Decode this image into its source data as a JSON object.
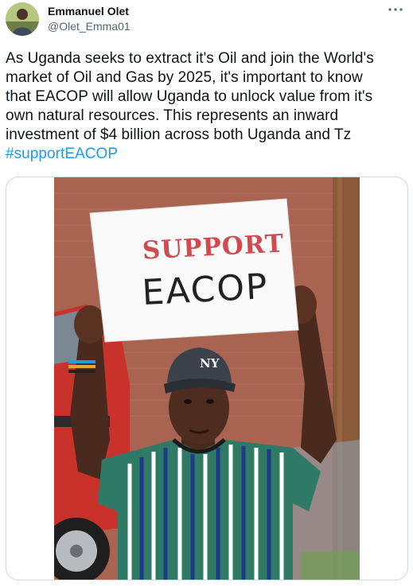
{
  "user": {
    "name": "Emmanuel Olet",
    "handle": "@Olet_Emma01"
  },
  "tweet": {
    "lines": [
      "As Uganda seeks to extract it's Oil and join the World's",
      "market of Oil and Gas by 2025, it's important to know",
      "that EACOP will allow Uganda to unlock value from it's",
      "own natural resources. This represents an inward",
      "investment of $4 billion across both Uganda and Tz"
    ],
    "hashtag": "#supportEACOP"
  },
  "media": {
    "sign_top": "SUPPORT",
    "sign_bottom": "EACOP",
    "cap_logo": "NY"
  },
  "icons": {
    "more": "more-horizontal-icon"
  },
  "colors": {
    "text": "#0f1419",
    "secondary": "#536471",
    "link": "#1d9bf0",
    "border": "#cfd9de"
  }
}
